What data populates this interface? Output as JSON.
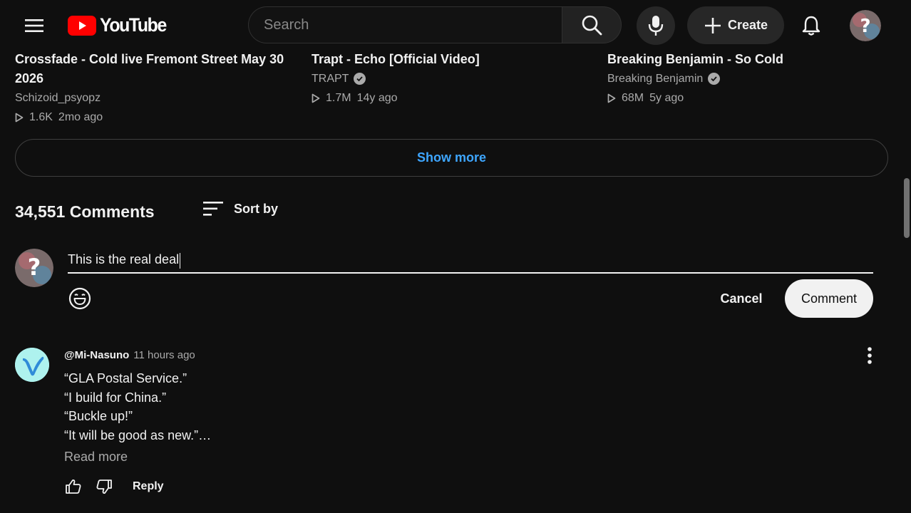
{
  "header": {
    "logo_text": "YouTube",
    "search_placeholder": "Search",
    "create_label": "Create"
  },
  "related": [
    {
      "title": "Crossfade - Cold live Fremont Street May 30 2026",
      "channel": "Schizoid_psyopz",
      "verified": false,
      "views": "1.6K",
      "age": "2mo ago"
    },
    {
      "title": "Trapt - Echo [Official Video]",
      "channel": "TRAPT",
      "verified": true,
      "views": "1.7M",
      "age": "14y ago"
    },
    {
      "title": "Breaking Benjamin - So Cold",
      "channel": "Breaking Benjamin",
      "verified": true,
      "views": "68M",
      "age": "5y ago"
    }
  ],
  "show_more_label": "Show more",
  "comments": {
    "count_label": "34,551 Comments",
    "sort_label": "Sort by",
    "draft_text": "This is the real deal",
    "cancel_label": "Cancel",
    "submit_label": "Comment",
    "items": [
      {
        "author": "@Mi-Nasuno",
        "time": "11 hours ago",
        "lines": [
          "“GLA Postal Service.”",
          "“I build for China.”",
          "“Buckle up!”",
          "“It will be good as new.”…"
        ],
        "read_more": "Read more",
        "reply_label": "Reply"
      }
    ]
  },
  "colors": {
    "background": "#0f0f0f",
    "text": "#f1f1f1",
    "secondary_text": "#aaaaaa",
    "link_blue": "#3ea6ff",
    "brand_red": "#ff0000"
  },
  "icons": [
    "menu-icon",
    "youtube-logo-icon",
    "search-icon",
    "mic-icon",
    "plus-icon",
    "bell-icon",
    "avatar",
    "verified-icon",
    "play-icon",
    "sort-icon",
    "emoji-icon",
    "like-icon",
    "dislike-icon",
    "more-vert-icon"
  ]
}
